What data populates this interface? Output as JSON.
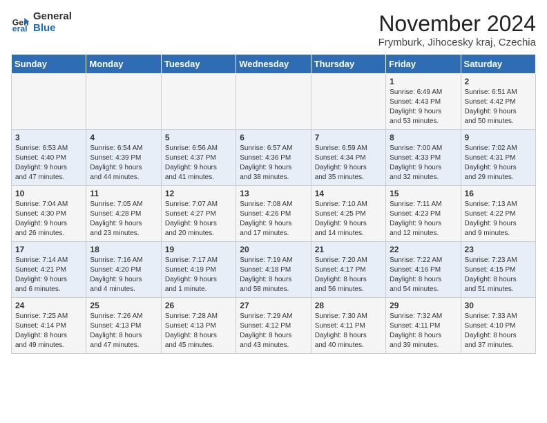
{
  "header": {
    "logo_general": "General",
    "logo_blue": "Blue",
    "month_title": "November 2024",
    "subtitle": "Frymburk, Jihocesky kraj, Czechia"
  },
  "days_of_week": [
    "Sunday",
    "Monday",
    "Tuesday",
    "Wednesday",
    "Thursday",
    "Friday",
    "Saturday"
  ],
  "weeks": [
    [
      {
        "day": "",
        "info": ""
      },
      {
        "day": "",
        "info": ""
      },
      {
        "day": "",
        "info": ""
      },
      {
        "day": "",
        "info": ""
      },
      {
        "day": "",
        "info": ""
      },
      {
        "day": "1",
        "info": "Sunrise: 6:49 AM\nSunset: 4:43 PM\nDaylight: 9 hours\nand 53 minutes."
      },
      {
        "day": "2",
        "info": "Sunrise: 6:51 AM\nSunset: 4:42 PM\nDaylight: 9 hours\nand 50 minutes."
      }
    ],
    [
      {
        "day": "3",
        "info": "Sunrise: 6:53 AM\nSunset: 4:40 PM\nDaylight: 9 hours\nand 47 minutes."
      },
      {
        "day": "4",
        "info": "Sunrise: 6:54 AM\nSunset: 4:39 PM\nDaylight: 9 hours\nand 44 minutes."
      },
      {
        "day": "5",
        "info": "Sunrise: 6:56 AM\nSunset: 4:37 PM\nDaylight: 9 hours\nand 41 minutes."
      },
      {
        "day": "6",
        "info": "Sunrise: 6:57 AM\nSunset: 4:36 PM\nDaylight: 9 hours\nand 38 minutes."
      },
      {
        "day": "7",
        "info": "Sunrise: 6:59 AM\nSunset: 4:34 PM\nDaylight: 9 hours\nand 35 minutes."
      },
      {
        "day": "8",
        "info": "Sunrise: 7:00 AM\nSunset: 4:33 PM\nDaylight: 9 hours\nand 32 minutes."
      },
      {
        "day": "9",
        "info": "Sunrise: 7:02 AM\nSunset: 4:31 PM\nDaylight: 9 hours\nand 29 minutes."
      }
    ],
    [
      {
        "day": "10",
        "info": "Sunrise: 7:04 AM\nSunset: 4:30 PM\nDaylight: 9 hours\nand 26 minutes."
      },
      {
        "day": "11",
        "info": "Sunrise: 7:05 AM\nSunset: 4:28 PM\nDaylight: 9 hours\nand 23 minutes."
      },
      {
        "day": "12",
        "info": "Sunrise: 7:07 AM\nSunset: 4:27 PM\nDaylight: 9 hours\nand 20 minutes."
      },
      {
        "day": "13",
        "info": "Sunrise: 7:08 AM\nSunset: 4:26 PM\nDaylight: 9 hours\nand 17 minutes."
      },
      {
        "day": "14",
        "info": "Sunrise: 7:10 AM\nSunset: 4:25 PM\nDaylight: 9 hours\nand 14 minutes."
      },
      {
        "day": "15",
        "info": "Sunrise: 7:11 AM\nSunset: 4:23 PM\nDaylight: 9 hours\nand 12 minutes."
      },
      {
        "day": "16",
        "info": "Sunrise: 7:13 AM\nSunset: 4:22 PM\nDaylight: 9 hours\nand 9 minutes."
      }
    ],
    [
      {
        "day": "17",
        "info": "Sunrise: 7:14 AM\nSunset: 4:21 PM\nDaylight: 9 hours\nand 6 minutes."
      },
      {
        "day": "18",
        "info": "Sunrise: 7:16 AM\nSunset: 4:20 PM\nDaylight: 9 hours\nand 4 minutes."
      },
      {
        "day": "19",
        "info": "Sunrise: 7:17 AM\nSunset: 4:19 PM\nDaylight: 9 hours\nand 1 minute."
      },
      {
        "day": "20",
        "info": "Sunrise: 7:19 AM\nSunset: 4:18 PM\nDaylight: 8 hours\nand 58 minutes."
      },
      {
        "day": "21",
        "info": "Sunrise: 7:20 AM\nSunset: 4:17 PM\nDaylight: 8 hours\nand 56 minutes."
      },
      {
        "day": "22",
        "info": "Sunrise: 7:22 AM\nSunset: 4:16 PM\nDaylight: 8 hours\nand 54 minutes."
      },
      {
        "day": "23",
        "info": "Sunrise: 7:23 AM\nSunset: 4:15 PM\nDaylight: 8 hours\nand 51 minutes."
      }
    ],
    [
      {
        "day": "24",
        "info": "Sunrise: 7:25 AM\nSunset: 4:14 PM\nDaylight: 8 hours\nand 49 minutes."
      },
      {
        "day": "25",
        "info": "Sunrise: 7:26 AM\nSunset: 4:13 PM\nDaylight: 8 hours\nand 47 minutes."
      },
      {
        "day": "26",
        "info": "Sunrise: 7:28 AM\nSunset: 4:13 PM\nDaylight: 8 hours\nand 45 minutes."
      },
      {
        "day": "27",
        "info": "Sunrise: 7:29 AM\nSunset: 4:12 PM\nDaylight: 8 hours\nand 43 minutes."
      },
      {
        "day": "28",
        "info": "Sunrise: 7:30 AM\nSunset: 4:11 PM\nDaylight: 8 hours\nand 40 minutes."
      },
      {
        "day": "29",
        "info": "Sunrise: 7:32 AM\nSunset: 4:11 PM\nDaylight: 8 hours\nand 39 minutes."
      },
      {
        "day": "30",
        "info": "Sunrise: 7:33 AM\nSunset: 4:10 PM\nDaylight: 8 hours\nand 37 minutes."
      }
    ]
  ]
}
